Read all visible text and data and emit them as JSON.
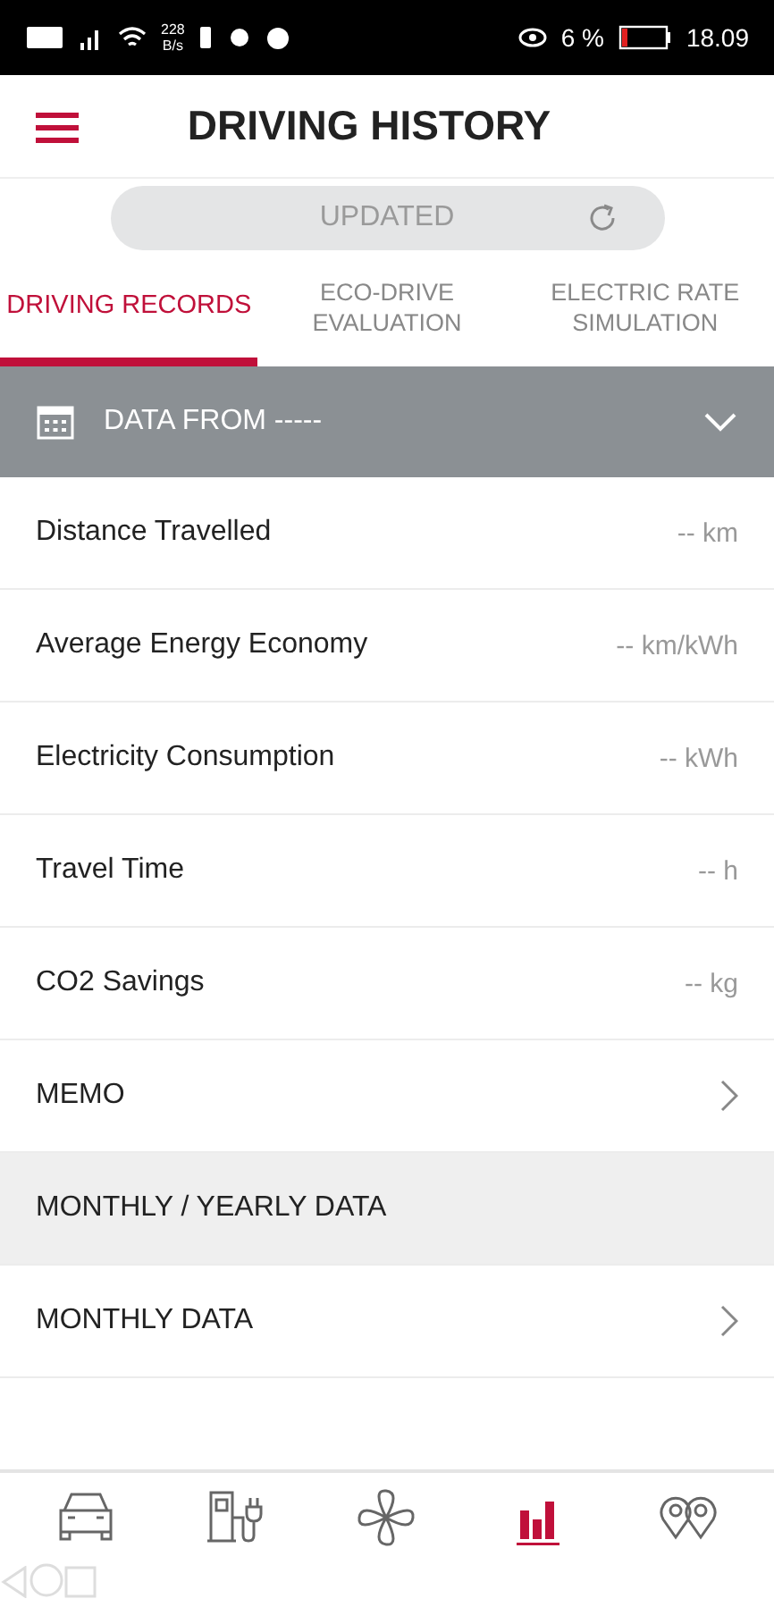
{
  "status_bar": {
    "speed": "228",
    "speed_unit": "B/s",
    "battery_percent": "6 %",
    "time": "18.09"
  },
  "header": {
    "title": "DRIVING HISTORY"
  },
  "update": {
    "label": "UPDATED"
  },
  "tabs": [
    {
      "label": "DRIVING RECORDS",
      "selected": true
    },
    {
      "label": "ECO-DRIVE\nEVALUATION",
      "selected": false
    },
    {
      "label": "ELECTRIC RATE\nSIMULATION",
      "selected": false
    }
  ],
  "period": {
    "label": "DATA FROM -----",
    "expanded": false
  },
  "rows": [
    {
      "kind": "stat",
      "label": "Distance Travelled",
      "value": "-- km"
    },
    {
      "kind": "stat",
      "label": "Average Energy Economy",
      "value": "-- km/kWh"
    },
    {
      "kind": "stat",
      "label": "Electricity Consumption",
      "value": "-- kWh"
    },
    {
      "kind": "stat",
      "label": "Travel Time",
      "value": "-- h"
    },
    {
      "kind": "stat",
      "label": "CO2 Savings",
      "value": "-- kg"
    },
    {
      "kind": "link",
      "label": "MEMO"
    },
    {
      "kind": "section",
      "label": "MONTHLY / YEARLY DATA"
    },
    {
      "kind": "link",
      "label": "MONTHLY DATA"
    },
    {
      "kind": "blank"
    }
  ],
  "bottom_nav": [
    {
      "kind": "car",
      "selected": false
    },
    {
      "kind": "charger",
      "selected": false
    },
    {
      "kind": "fan",
      "selected": false
    },
    {
      "kind": "chart",
      "selected": true
    },
    {
      "kind": "pins",
      "selected": false
    }
  ]
}
